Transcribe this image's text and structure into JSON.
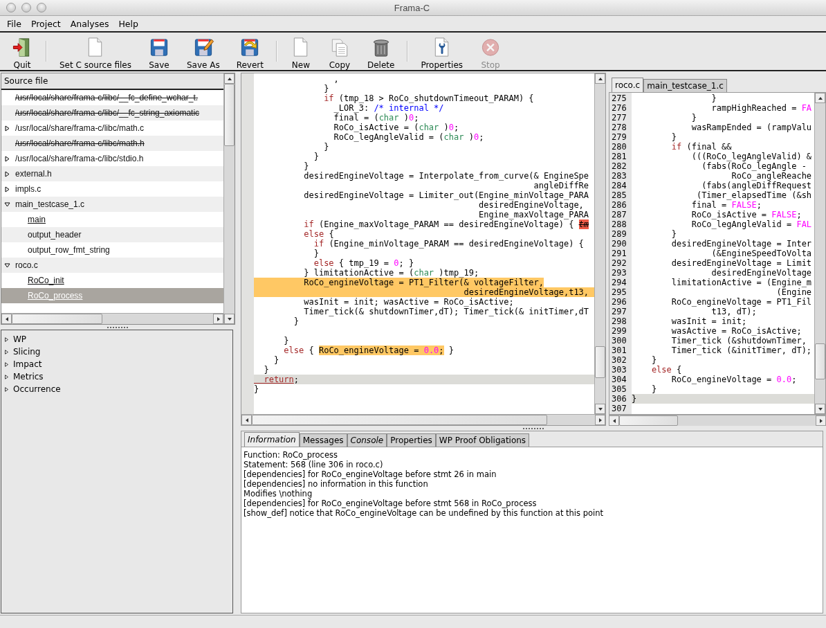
{
  "window": {
    "title": "Frama-C"
  },
  "menu": [
    "File",
    "Project",
    "Analyses",
    "Help"
  ],
  "toolbar": {
    "groups": [
      [
        {
          "kind": "quit",
          "label": "Quit",
          "disabled": false
        }
      ],
      [
        {
          "kind": "source",
          "label": "Set C source files",
          "disabled": false
        },
        {
          "kind": "save",
          "label": "Save",
          "disabled": false
        },
        {
          "kind": "saveas",
          "label": "Save As",
          "disabled": false
        },
        {
          "kind": "revert",
          "label": "Revert",
          "disabled": false
        }
      ],
      [
        {
          "kind": "new",
          "label": "New",
          "disabled": false
        },
        {
          "kind": "copy",
          "label": "Copy",
          "disabled": false
        },
        {
          "kind": "delete",
          "label": "Delete",
          "disabled": false
        }
      ],
      [
        {
          "kind": "properties",
          "label": "Properties",
          "disabled": false
        },
        {
          "kind": "stop",
          "label": "Stop",
          "disabled": true
        }
      ]
    ]
  },
  "source_tree": {
    "column": "Source file",
    "items": [
      {
        "label": "/usr/local/share/frama-c/libc/__fc_define_wchar_t.",
        "expandable": false,
        "expanded": false,
        "struck": true
      },
      {
        "label": "/usr/local/share/frama-c/libc/__fc_string_axiomatic",
        "expandable": false,
        "expanded": false,
        "struck": true
      },
      {
        "label": "/usr/local/share/frama-c/libc/math.c",
        "expandable": true,
        "expanded": false,
        "struck": false
      },
      {
        "label": "/usr/local/share/frama-c/libc/math.h",
        "expandable": false,
        "expanded": false,
        "struck": true
      },
      {
        "label": "/usr/local/share/frama-c/libc/stdio.h",
        "expandable": true,
        "expanded": false,
        "struck": false
      },
      {
        "label": "external.h",
        "expandable": true,
        "expanded": false,
        "struck": false
      },
      {
        "label": "impls.c",
        "expandable": true,
        "expanded": false,
        "struck": false
      },
      {
        "label": "main_testcase_1.c",
        "expandable": true,
        "expanded": true,
        "struck": false,
        "children": [
          {
            "label": "main",
            "underlined": true,
            "selected": false
          },
          {
            "label": "output_header",
            "underlined": false,
            "selected": false
          },
          {
            "label": "output_row_fmt_string",
            "underlined": false,
            "selected": false
          }
        ]
      },
      {
        "label": "roco.c",
        "expandable": true,
        "expanded": true,
        "struck": false,
        "children": [
          {
            "label": "RoCo_init",
            "underlined": true,
            "selected": false
          },
          {
            "label": "RoCo_process",
            "underlined": true,
            "selected": true
          }
        ]
      }
    ]
  },
  "plugins": [
    {
      "label": "WP",
      "expanded": false
    },
    {
      "label": "Slicing",
      "expanded": false
    },
    {
      "label": "Impact",
      "expanded": false
    },
    {
      "label": "Metrics",
      "expanded": false
    },
    {
      "label": "Occurrence",
      "expanded": false
    }
  ],
  "code_view": {
    "lines": [
      {
        "segments": [
          {
            "text": "                ,"
          }
        ]
      },
      {
        "segments": [
          {
            "text": "              }"
          }
        ]
      },
      {
        "segments": [
          {
            "text": "              if",
            "kind": "keyword"
          },
          {
            "text": " (tmp_18 > RoCo_shutdownTimeout_PARAM) {"
          }
        ]
      },
      {
        "segments": [
          {
            "text": "                _LOR_3: "
          },
          {
            "text": "/* internal */",
            "kind": "comment"
          }
        ]
      },
      {
        "segments": [
          {
            "text": "                final = ("
          },
          {
            "text": "char",
            "kind": "type"
          },
          {
            "text": " )"
          },
          {
            "text": "0",
            "kind": "number"
          },
          {
            "text": ";"
          }
        ]
      },
      {
        "segments": [
          {
            "text": "                RoCo_isActive = ("
          },
          {
            "text": "char",
            "kind": "type"
          },
          {
            "text": " )"
          },
          {
            "text": "0",
            "kind": "number"
          },
          {
            "text": ";"
          }
        ]
      },
      {
        "segments": [
          {
            "text": "                RoCo_legAngleValid = ("
          },
          {
            "text": "char",
            "kind": "type"
          },
          {
            "text": " )"
          },
          {
            "text": "0",
            "kind": "number"
          },
          {
            "text": ";"
          }
        ]
      },
      {
        "segments": [
          {
            "text": "              }"
          }
        ]
      },
      {
        "segments": [
          {
            "text": "            }"
          }
        ]
      },
      {
        "segments": [
          {
            "text": "          }"
          }
        ]
      },
      {
        "segments": [
          {
            "text": "          desiredEngineVoltage = Interpolate_from_curve(& EngineSpe"
          }
        ]
      },
      {
        "segments": [
          {
            "text": "                                                        angleDiffRe"
          }
        ]
      },
      {
        "segments": [
          {
            "text": "          desiredEngineVoltage = Limiter_out(Engine_minVoltage_PARA"
          }
        ]
      },
      {
        "segments": [
          {
            "text": "                                             desiredEngineVoltage,"
          }
        ]
      },
      {
        "segments": [
          {
            "text": "                                             Engine_maxVoltage_PARA"
          }
        ]
      },
      {
        "segments": [
          {
            "text": "          if",
            "kind": "keyword"
          },
          {
            "text": " (Engine_maxVoltage_PARAM == desiredEngineVoltage) { "
          },
          {
            "text": "tm",
            "kind": "dead",
            "alarm": true
          }
        ]
      },
      {
        "segments": [
          {
            "text": "          else",
            "kind": "keyword"
          },
          {
            "text": " {"
          }
        ]
      },
      {
        "segments": [
          {
            "text": "            if",
            "kind": "keyword"
          },
          {
            "text": " (Engine_minVoltage_PARAM == desiredEngineVoltage) {"
          }
        ]
      },
      {
        "segments": [
          {
            "text": "            }"
          }
        ]
      },
      {
        "segments": [
          {
            "text": "            else",
            "kind": "keyword"
          },
          {
            "text": " { tmp_19 = "
          },
          {
            "text": "0",
            "kind": "number"
          },
          {
            "text": "; }"
          }
        ]
      },
      {
        "segments": [
          {
            "text": "          } limitationActive = ("
          },
          {
            "text": "char",
            "kind": "type"
          },
          {
            "text": " )tmp_19;"
          }
        ]
      },
      {
        "segments": [
          {
            "text": "          RoCo_engineVoltage = PT1_Filter(& voltageFilter,",
            "marked": true
          }
        ]
      },
      {
        "marked": true,
        "segments": [
          {
            "text": "                                          desiredEngineVoltage,t13,"
          }
        ]
      },
      {
        "segments": [
          {
            "text": "          wasInit = init; wasActive = RoCo_isActive;"
          }
        ]
      },
      {
        "segments": [
          {
            "text": "          Timer_tick(& shutdownTimer,dT); Timer_tick(& initTimer,dT"
          }
        ]
      },
      {
        "segments": [
          {
            "text": "        }"
          }
        ]
      },
      {
        "blank": true
      },
      {
        "segments": [
          {
            "text": "      }"
          }
        ]
      },
      {
        "segments": [
          {
            "text": "      else",
            "kind": "keyword"
          },
          {
            "text": " { "
          },
          {
            "text": "RoCo_engineVoltage = ",
            "marked": true
          },
          {
            "text": "0.0",
            "kind": "number",
            "marked": true
          },
          {
            "text": ";",
            "marked": true
          },
          {
            "text": " }"
          }
        ]
      },
      {
        "segments": [
          {
            "text": "    }"
          }
        ]
      },
      {
        "segments": [
          {
            "text": "  }"
          }
        ]
      },
      {
        "current": true,
        "segments": [
          {
            "text": "  return",
            "kind": "call"
          },
          {
            "text": ";"
          }
        ]
      },
      {
        "segments": [
          {
            "text": "}"
          }
        ]
      }
    ]
  },
  "file_tabs": [
    {
      "label": "roco.c",
      "selected": true
    },
    {
      "label": "main_testcase_1.c",
      "selected": false
    }
  ],
  "source_view": {
    "lines": [
      {
        "number": "275",
        "segments": [
          {
            "text": "                }"
          }
        ]
      },
      {
        "number": "276",
        "segments": [
          {
            "text": "                rampHighReached = "
          },
          {
            "text": "FA",
            "kind": "number"
          }
        ]
      },
      {
        "number": "277",
        "segments": [
          {
            "text": "            }"
          }
        ]
      },
      {
        "number": "278",
        "segments": [
          {
            "text": "            wasRampEnded = (rampValu"
          }
        ]
      },
      {
        "number": "279",
        "segments": [
          {
            "text": "        }"
          }
        ]
      },
      {
        "number": "280",
        "segments": [
          {
            "text": "        if",
            "kind": "keyword"
          },
          {
            "text": " (final &&"
          }
        ]
      },
      {
        "number": "281",
        "segments": [
          {
            "text": "            (((RoCo_legAngleValid) &"
          }
        ]
      },
      {
        "number": "282",
        "segments": [
          {
            "text": "              (fabs(RoCo_legAngle -"
          }
        ]
      },
      {
        "number": "283",
        "segments": [
          {
            "text": "                    RoCo_angleReache"
          }
        ]
      },
      {
        "number": "284",
        "segments": [
          {
            "text": "              (fabs(angleDiffRequest"
          }
        ]
      },
      {
        "number": "285",
        "segments": [
          {
            "text": "             (Timer_elapsedTime (&sh"
          }
        ]
      },
      {
        "number": "286",
        "segments": [
          {
            "text": "            final = "
          },
          {
            "text": "FALSE",
            "kind": "number"
          },
          {
            "text": ";"
          }
        ]
      },
      {
        "number": "287",
        "segments": [
          {
            "text": "            RoCo_isActive = "
          },
          {
            "text": "FALSE",
            "kind": "number"
          },
          {
            "text": ";"
          }
        ]
      },
      {
        "number": "288",
        "segments": [
          {
            "text": "            RoCo_legAngleValid = "
          },
          {
            "text": "FAL",
            "kind": "number"
          }
        ]
      },
      {
        "number": "289",
        "segments": [
          {
            "text": "        }"
          }
        ]
      },
      {
        "number": "290",
        "segments": [
          {
            "text": "        desiredEngineVoltage = Inter"
          }
        ]
      },
      {
        "number": "291",
        "segments": [
          {
            "text": "                (&EngineSpeedToVolta"
          }
        ]
      },
      {
        "number": "292",
        "segments": [
          {
            "text": "        desiredEngineVoltage = Limit"
          }
        ]
      },
      {
        "number": "293",
        "segments": [
          {
            "text": "                desiredEngineVoltage"
          }
        ]
      },
      {
        "number": "294",
        "segments": [
          {
            "text": "        limitationActive = (Engine_m"
          }
        ]
      },
      {
        "number": "295",
        "segments": [
          {
            "text": "                             (Engine"
          }
        ]
      },
      {
        "number": "296",
        "segments": [
          {
            "text": "        RoCo_engineVoltage = PT1_Fil"
          }
        ]
      },
      {
        "number": "297",
        "segments": [
          {
            "text": "                t13, dT);"
          }
        ]
      },
      {
        "number": "298",
        "segments": [
          {
            "text": "        wasInit = init;"
          }
        ]
      },
      {
        "number": "299",
        "segments": [
          {
            "text": "        wasActive = RoCo_isActive;"
          }
        ]
      },
      {
        "number": "300",
        "segments": [
          {
            "text": "        Timer_tick (&shutdownTimer,"
          }
        ]
      },
      {
        "number": "301",
        "segments": [
          {
            "text": "        Timer_tick (&initTimer, dT);"
          }
        ]
      },
      {
        "number": "302",
        "segments": [
          {
            "text": "    }"
          }
        ]
      },
      {
        "number": "303",
        "segments": [
          {
            "text": "    else",
            "kind": "keyword"
          },
          {
            "text": " {"
          }
        ]
      },
      {
        "number": "304",
        "segments": [
          {
            "text": "        RoCo_engineVoltage = "
          },
          {
            "text": "0.0",
            "kind": "number"
          },
          {
            "text": ";"
          }
        ]
      },
      {
        "number": "305",
        "segments": [
          {
            "text": "    }"
          }
        ]
      },
      {
        "number": "306",
        "current": true,
        "segments": [
          {
            "text": "}"
          }
        ]
      },
      {
        "number": "307"
      }
    ]
  },
  "info_tabs": [
    {
      "label": "Information",
      "selected": true,
      "italic": true
    },
    {
      "label": "Messages",
      "selected": false,
      "italic": false
    },
    {
      "label": "Console",
      "selected": false,
      "italic": true
    },
    {
      "label": "Properties",
      "selected": false,
      "italic": false
    },
    {
      "label": "WP Proof Obligations",
      "selected": false,
      "italic": false
    }
  ],
  "information": [
    "Function: RoCo_process",
    "Statement: 568 (line 306 in roco.c)",
    "[dependencies] for RoCo_engineVoltage before stmt 26 in main",
    "[dependencies] no information in this function",
    "Modifies \\nothing",
    "[dependencies] for RoCo_engineVoltage before stmt 568 in RoCo_process",
    "[show_def] notice that RoCo_engineVoltage can be undefined by this function at this point"
  ]
}
